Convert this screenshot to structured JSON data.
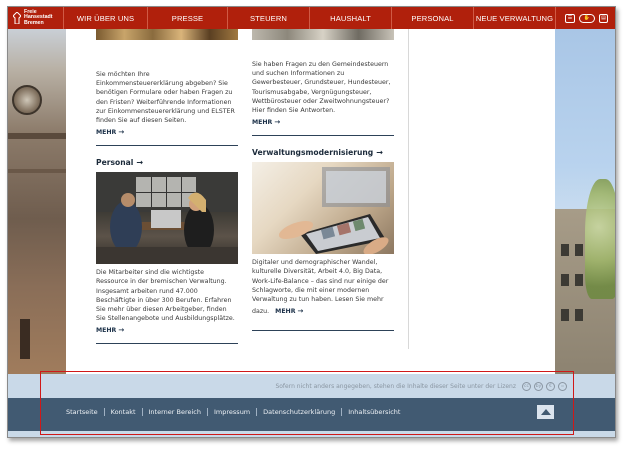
{
  "logo": {
    "line1": "Freie",
    "line2": "Hansestadt",
    "line3": "Bremen"
  },
  "nav": {
    "items": [
      "WIR ÜBER UNS",
      "PRESSE",
      "STEUERN",
      "HAUSHALT",
      "PERSONAL",
      "NEUE VERWALTUNG"
    ],
    "tools": [
      "easy-language-icon",
      "sign-language-icon",
      "reading-icon"
    ]
  },
  "main": {
    "col1_top": {
      "text": "Sie möchten Ihre Einkommensteuererklärung abgeben? Sie benötigen Formulare oder haben Fragen zu den Fristen? Weiterführende Informationen zur Einkommensteuererklärung und ELSTER finden Sie auf diesen Seiten.",
      "more": "MEHR"
    },
    "col2_top": {
      "text": "Sie haben Fragen zu den Gemeindesteuern und suchen Informationen zu Gewerbesteuer, Grundsteuer, Hundesteuer, Tourismusabgabe, Vergnügungsteuer, Wettbürosteuer oder Zweitwohnungsteuer? Hier finden Sie Antworten.",
      "more": "MEHR"
    },
    "col1_bottom": {
      "heading": "Personal",
      "text": "Die Mitarbeiter sind die wichtigste Ressource in der bremischen Verwaltung. Insgesamt arbeiten rund 47.000 Beschäftigte in über 300 Berufen. Erfahren Sie mehr über diesen Arbeitgeber, finden Sie Stellenangebote und Ausbildungsplätze.",
      "more": "MEHR"
    },
    "col2_bottom": {
      "heading": "Verwaltungsmodernisierung",
      "text": "Digitaler und demographischer Wandel, kulturelle Diversität, Arbeit 4.0, Big Data, Work-Life-Balance – das sind nur einige der Schlagworte, die mit einer modernen Verwaltung zu tun haben. Lesen Sie mehr dazu.",
      "more": "MEHR"
    }
  },
  "license": {
    "text": "Sofern nicht anders angegeben, stehen die Inhalte dieser Seite unter der Lizenz",
    "icons": [
      "cc",
      "by",
      "€",
      "="
    ]
  },
  "footer": {
    "links": [
      "Startseite",
      "Kontakt",
      "Interner Bereich",
      "Impressum",
      "Datenschutzerklärung",
      "Inhaltsübersicht"
    ]
  },
  "colors": {
    "nav_red": "#b0200c",
    "footer_blue": "#415a72",
    "license_bar": "#c9d9e8"
  }
}
